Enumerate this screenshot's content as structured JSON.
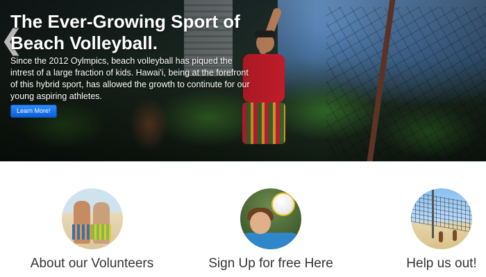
{
  "hero": {
    "title": "The Ever-Growing Sport of Beach Volleyball.",
    "description": "Since the 2012 Oylmpics, beach volleyball has piqued the intrest of a large fraction of kids. Hawai'i, being at the forefront of this hybrid sport, has allowed the growth to continute for our young aspiring athletes.",
    "cta_label": "Learn More!",
    "prev_arrow": "❮"
  },
  "features": [
    {
      "label": "About our Volunteers",
      "image": "volunteers-photo"
    },
    {
      "label": "Sign Up for free Here",
      "image": "player-with-ball-photo"
    },
    {
      "label": "Help us out!",
      "image": "volleyball-net-beach-photo"
    }
  ],
  "colors": {
    "cta_background": "#1a6fe8",
    "feature_text": "#333333"
  }
}
